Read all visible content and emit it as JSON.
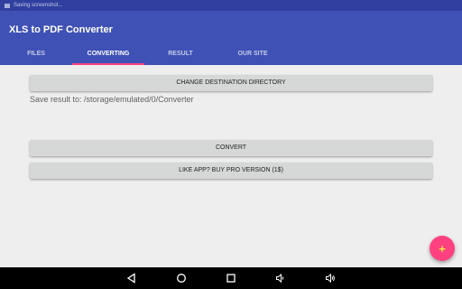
{
  "statusbar": {
    "text": "Saving screenshot..."
  },
  "appbar": {
    "title": "XLS to PDF Converter",
    "tabs": [
      {
        "label": "FILES",
        "active": false
      },
      {
        "label": "CONVERTING",
        "active": true
      },
      {
        "label": "RESULT",
        "active": false
      },
      {
        "label": "OUR SITE",
        "active": false
      }
    ]
  },
  "main": {
    "change_dir_label": "CHANGE DESTINATION DIRECTORY",
    "save_result_text": "Save result to: /storage/emulated/0/Converter",
    "convert_label": "CONVERT",
    "pro_label": "LIKE APP? BUY PRO VERSION (1$)"
  },
  "fab": {
    "icon": "plus-icon",
    "symbol": "+"
  },
  "navbar": {
    "icons": [
      "back-icon",
      "home-icon",
      "recents-icon",
      "volume-down-icon",
      "volume-up-icon"
    ]
  },
  "colors": {
    "primary": "#3f51b5",
    "primary_dark": "#303f9f",
    "accent": "#ff4081",
    "background": "#eeeeee"
  }
}
